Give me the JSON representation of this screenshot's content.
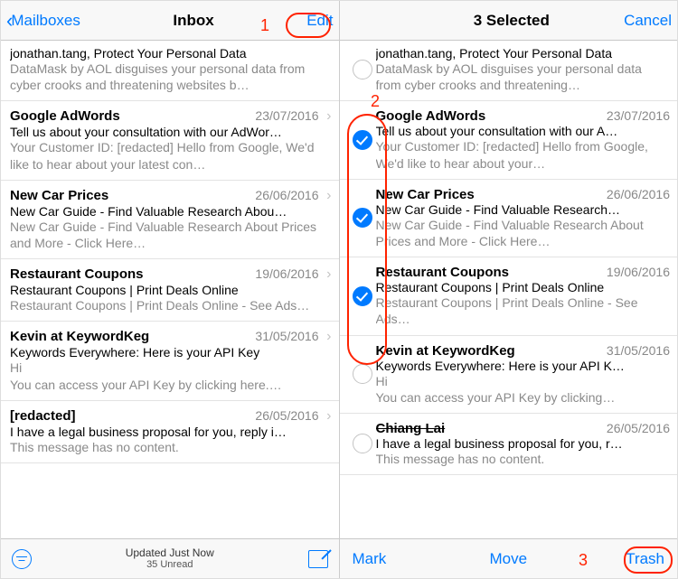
{
  "left": {
    "nav": {
      "back": "Mailboxes",
      "title": "Inbox",
      "right": "Edit"
    },
    "rows": [
      {
        "sender": "jonathan.tang, Protect Your Personal Data",
        "date": "",
        "subject": "DataMask by AOL disguises your personal data",
        "preview": "from cyber crooks and threatening websites b…",
        "showChevron": false,
        "top": true
      },
      {
        "sender": "Google AdWords",
        "date": "23/07/2016",
        "subject": "Tell us about your consultation with our AdWor…",
        "preview": "Your Customer ID: [redacted] Hello from Google, We'd like to hear about your latest con…",
        "showChevron": true
      },
      {
        "sender": "New Car Prices",
        "date": "26/06/2016",
        "subject": "New Car Guide - Find Valuable Research Abou…",
        "preview": "New Car Guide - Find Valuable Research About Prices and More - Click Here…",
        "showChevron": true
      },
      {
        "sender": "Restaurant Coupons",
        "date": "19/06/2016",
        "subject": "Restaurant Coupons | Print Deals Online",
        "preview": "Restaurant Coupons | Print Deals Online - See Ads…",
        "showChevron": true
      },
      {
        "sender": "Kevin at KeywordKeg",
        "date": "31/05/2016",
        "subject": "Keywords Everywhere: Here is your API Key",
        "preview": "Hi\nYou can access your API Key by clicking here.…",
        "showChevron": true
      },
      {
        "sender": "[redacted]",
        "date": "26/05/2016",
        "subject": "I have a legal business proposal for you, reply i…",
        "preview": "This message has no content.",
        "showChevron": true
      }
    ],
    "toolbar": {
      "updated": "Updated Just Now",
      "unread": "35 Unread"
    }
  },
  "right": {
    "nav": {
      "title": "3 Selected",
      "right": "Cancel"
    },
    "rows": [
      {
        "sender": "jonathan.tang, Protect Your Personal Data",
        "date": "",
        "subject": "DataMask by AOL disguises your personal",
        "preview": "data from cyber crooks and threatening…",
        "checked": false,
        "top": true
      },
      {
        "sender": "Google AdWords",
        "date": "23/07/2016",
        "subject": "Tell us about your consultation with our A…",
        "preview": "Your Customer ID: [redacted] Hello from Google, We'd like to hear about your…",
        "checked": true
      },
      {
        "sender": "New Car Prices",
        "date": "26/06/2016",
        "subject": "New Car Guide - Find Valuable Research…",
        "preview": "New Car Guide - Find Valuable Research About Prices and More - Click Here…",
        "checked": true
      },
      {
        "sender": "Restaurant Coupons",
        "date": "19/06/2016",
        "subject": "Restaurant Coupons | Print Deals Online",
        "preview": "Restaurant Coupons | Print Deals Online - See Ads…",
        "checked": true
      },
      {
        "sender": "Kevin at KeywordKeg",
        "date": "31/05/2016",
        "subject": "Keywords Everywhere: Here is your API K…",
        "preview": "Hi\nYou can access your API Key by clicking…",
        "checked": false
      },
      {
        "sender": "Chiang Lai",
        "date": "26/05/2016",
        "subject": "I have a legal business proposal for you, r…",
        "preview": "This message has no content.",
        "checked": false,
        "struck": true
      }
    ],
    "actions": {
      "mark": "Mark",
      "move": "Move",
      "trash": "Trash"
    }
  },
  "annotations": {
    "n1": "1",
    "n2": "2",
    "n3": "3"
  }
}
